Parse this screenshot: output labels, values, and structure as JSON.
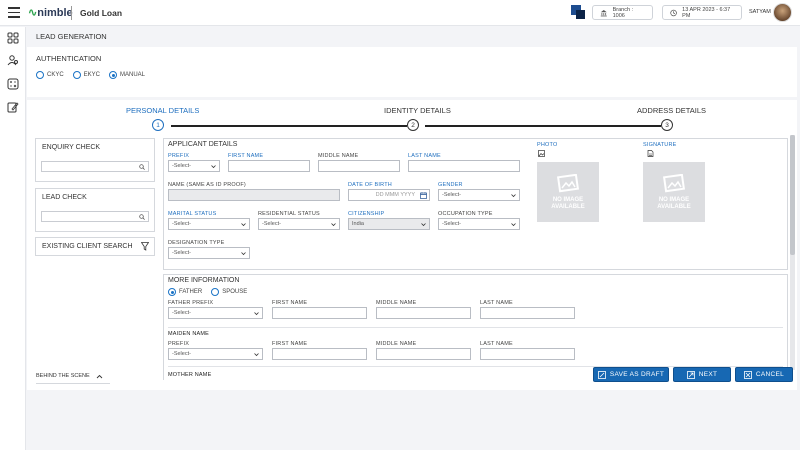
{
  "header": {
    "logo_text": "nimble",
    "app_title": "Gold Loan",
    "branch": "Branch : 1006",
    "datetime": "13 APR 2023 - 6:37 PM",
    "user": "SATYAM"
  },
  "page": {
    "title": "LEAD GENERATION",
    "authentication_label": "AUTHENTICATION",
    "auth_options": [
      "CKYC",
      "EKYC",
      "MANUAL"
    ],
    "auth_selected": "MANUAL"
  },
  "steps": [
    {
      "label": "PERSONAL DETAILS",
      "num": "1"
    },
    {
      "label": "IDENTITY DETAILS",
      "num": "2"
    },
    {
      "label": "ADDRESS DETAILS",
      "num": "3"
    }
  ],
  "left": {
    "enquiry_check": "ENQUIRY CHECK",
    "lead_check": "LEAD CHECK",
    "existing_client_search": "EXISTING CLIENT SEARCH",
    "behind_the_scene": "BEHIND THE SCENE"
  },
  "applicant": {
    "title": "APPLICANT DETAILS",
    "prefix_label": "PREFIX",
    "prefix_value": "-Select-",
    "first_name_label": "FIRST NAME",
    "middle_name_label": "MIDDLE NAME",
    "last_name_label": "LAST NAME",
    "name_as_id_label": "NAME (SAME AS ID PROOF)",
    "dob_label": "DATE OF BIRTH",
    "dob_placeholder": "DD MMM YYYY",
    "gender_label": "GENDER",
    "gender_value": "-Select-",
    "marital_label": "MARITAL STATUS",
    "marital_value": "-Select-",
    "residential_label": "RESIDENTIAL STATUS",
    "residential_value": "-Select-",
    "citizenship_label": "CITIZENSHIP",
    "citizenship_value": "India",
    "occupation_label": "OCCUPATION TYPE",
    "occupation_value": "-Select-",
    "designation_label": "DESIGNATION TYPE",
    "designation_value": "-Select-",
    "photo_label": "PHOTO",
    "signature_label": "SIGNATURE",
    "no_image_line1": "NO IMAGE",
    "no_image_line2": "AVAILABLE"
  },
  "more_info": {
    "title": "MORE INFORMATION",
    "radio_father": "FATHER",
    "radio_spouse": "SPOUSE",
    "father_prefix_label": "FATHER PREFIX",
    "father_prefix_value": "-Select-",
    "first_name_label": "FIRST NAME",
    "middle_name_label": "MIDDLE NAME",
    "last_name_label": "LAST NAME",
    "maiden_name_title": "MAIDEN NAME",
    "prefix_label": "PREFIX",
    "prefix_value": "-Select-",
    "mother_name_title": "MOTHER NAME"
  },
  "buttons": {
    "save_draft": "SAVE AS DRAFT",
    "next": "NEXT",
    "cancel": "CANCEL"
  },
  "colors": {
    "accent": "#1768b3",
    "active_step": "#1f6fbf"
  }
}
